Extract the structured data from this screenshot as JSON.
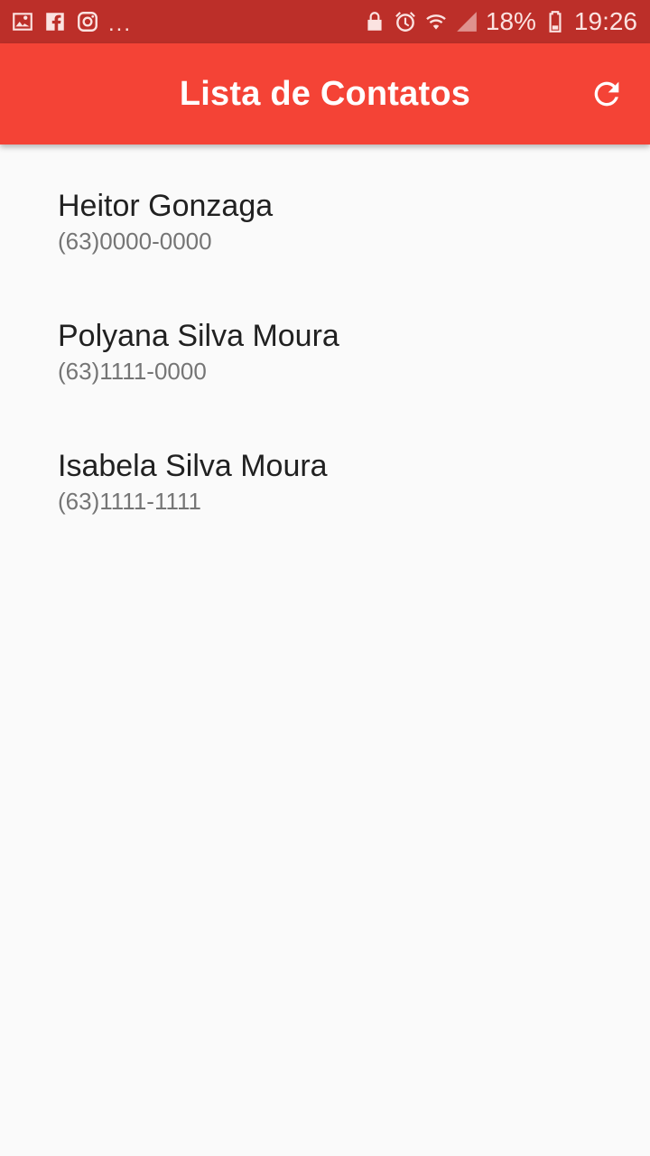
{
  "status_bar": {
    "left_icons": [
      "gallery-icon",
      "facebook-icon",
      "instagram-icon"
    ],
    "more": "...",
    "right_icons": [
      "lock-icon",
      "alarm-icon",
      "wifi-icon",
      "signal-icon",
      "battery-icon"
    ],
    "battery": "18%",
    "time": "19:26"
  },
  "app_bar": {
    "title": "Lista de Contatos",
    "refresh_icon": "refresh-icon",
    "color": "#f44336"
  },
  "contacts": [
    {
      "name": "Heitor Gonzaga",
      "phone": "(63)0000-0000"
    },
    {
      "name": "Polyana Silva Moura",
      "phone": "(63)1111-0000"
    },
    {
      "name": "Isabela Silva Moura",
      "phone": "(63)1111-1111"
    }
  ]
}
